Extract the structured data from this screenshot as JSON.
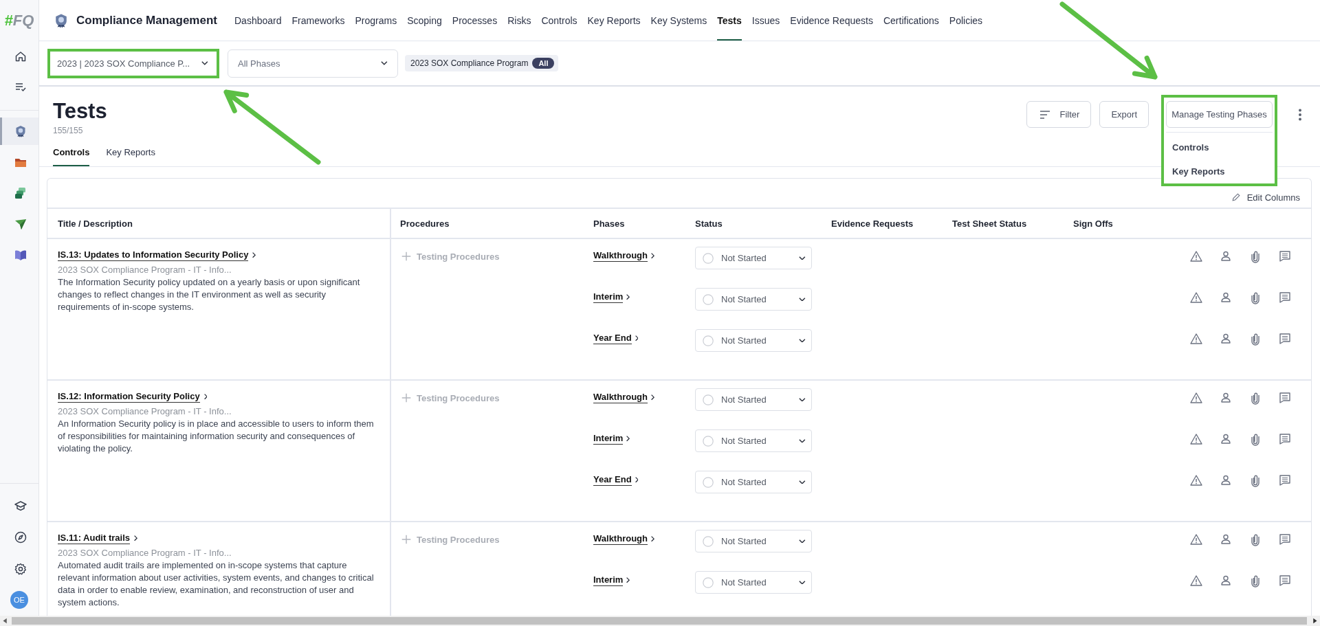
{
  "app": {
    "logo": {
      "mark": "#",
      "text": "FQ"
    },
    "title": "Compliance Management",
    "nav": [
      {
        "label": "Dashboard",
        "selected": false
      },
      {
        "label": "Frameworks",
        "selected": false
      },
      {
        "label": "Programs",
        "selected": false
      },
      {
        "label": "Scoping",
        "selected": false
      },
      {
        "label": "Processes",
        "selected": false
      },
      {
        "label": "Risks",
        "selected": false
      },
      {
        "label": "Controls",
        "selected": false
      },
      {
        "label": "Key Reports",
        "selected": false
      },
      {
        "label": "Key Systems",
        "selected": false
      },
      {
        "label": "Tests",
        "selected": true
      },
      {
        "label": "Issues",
        "selected": false
      },
      {
        "label": "Evidence Requests",
        "selected": false
      },
      {
        "label": "Certifications",
        "selected": false
      },
      {
        "label": "Policies",
        "selected": false
      }
    ]
  },
  "sidebar": {
    "top": [
      {
        "kind": "home",
        "selected": false
      },
      {
        "kind": "checklist",
        "selected": false
      }
    ],
    "apps": [
      {
        "kind": "badge",
        "selected": true
      },
      {
        "kind": "folder",
        "selected": false
      },
      {
        "kind": "cards",
        "selected": false
      },
      {
        "kind": "plane",
        "selected": false
      },
      {
        "kind": "book",
        "selected": false
      }
    ],
    "bottom": [
      {
        "kind": "cap",
        "selected": false
      },
      {
        "kind": "compass",
        "selected": false
      },
      {
        "kind": "gear",
        "selected": false
      }
    ],
    "avatar": "OE"
  },
  "filters": {
    "program": {
      "value": "2023 | 2023 SOX Compliance P...",
      "highlighted": true
    },
    "phase": {
      "value": "All Phases"
    },
    "chip": {
      "label": "2023 SOX Compliance Program",
      "badge": "All"
    }
  },
  "page": {
    "title": "Tests",
    "count": "155/155",
    "tabs": [
      {
        "label": "Controls",
        "selected": true
      },
      {
        "label": "Key Reports",
        "selected": false
      }
    ],
    "actions": {
      "filter": "Filter",
      "export": "Export",
      "manage": {
        "label": "Manage Testing Phases",
        "highlighted": true,
        "menu": [
          "Controls",
          "Key Reports"
        ]
      }
    }
  },
  "table": {
    "edit_columns": "Edit Columns",
    "columns": [
      "Title / Description",
      "Procedures",
      "Phases",
      "Status",
      "Evidence Requests",
      "Test Sheet Status",
      "Sign Offs"
    ],
    "rows": [
      {
        "title": "IS.13: Updates to Information Security Policy",
        "program": "2023 SOX Compliance Program - IT - Info...",
        "description": "The Information Security policy updated on a yearly basis or upon significant changes to reflect changes in the IT environment as well as security requirements of in-scope systems.",
        "procedures": "Testing Procedures",
        "phases": [
          {
            "name": "Walkthrough",
            "status": "Not Started"
          },
          {
            "name": "Interim",
            "status": "Not Started"
          },
          {
            "name": "Year End",
            "status": "Not Started"
          }
        ]
      },
      {
        "title": "IS.12: Information Security Policy",
        "program": "2023 SOX Compliance Program - IT - Info...",
        "description": "An Information Security policy is in place and accessible to users to inform them of responsibilities for maintaining information security and consequences of violating the policy.",
        "procedures": "Testing Procedures",
        "phases": [
          {
            "name": "Walkthrough",
            "status": "Not Started"
          },
          {
            "name": "Interim",
            "status": "Not Started"
          },
          {
            "name": "Year End",
            "status": "Not Started"
          }
        ]
      },
      {
        "title": "IS.11: Audit trails",
        "program": "2023 SOX Compliance Program - IT - Info...",
        "description": "Automated audit trails are implemented on in-scope systems that capture relevant information about user activities, system events, and changes to critical data in order to enable review, examination, and reconstruction of user and system actions.",
        "procedures": "Testing Procedures",
        "phases": [
          {
            "name": "Walkthrough",
            "status": "Not Started"
          },
          {
            "name": "Interim",
            "status": "Not Started"
          }
        ]
      }
    ]
  }
}
